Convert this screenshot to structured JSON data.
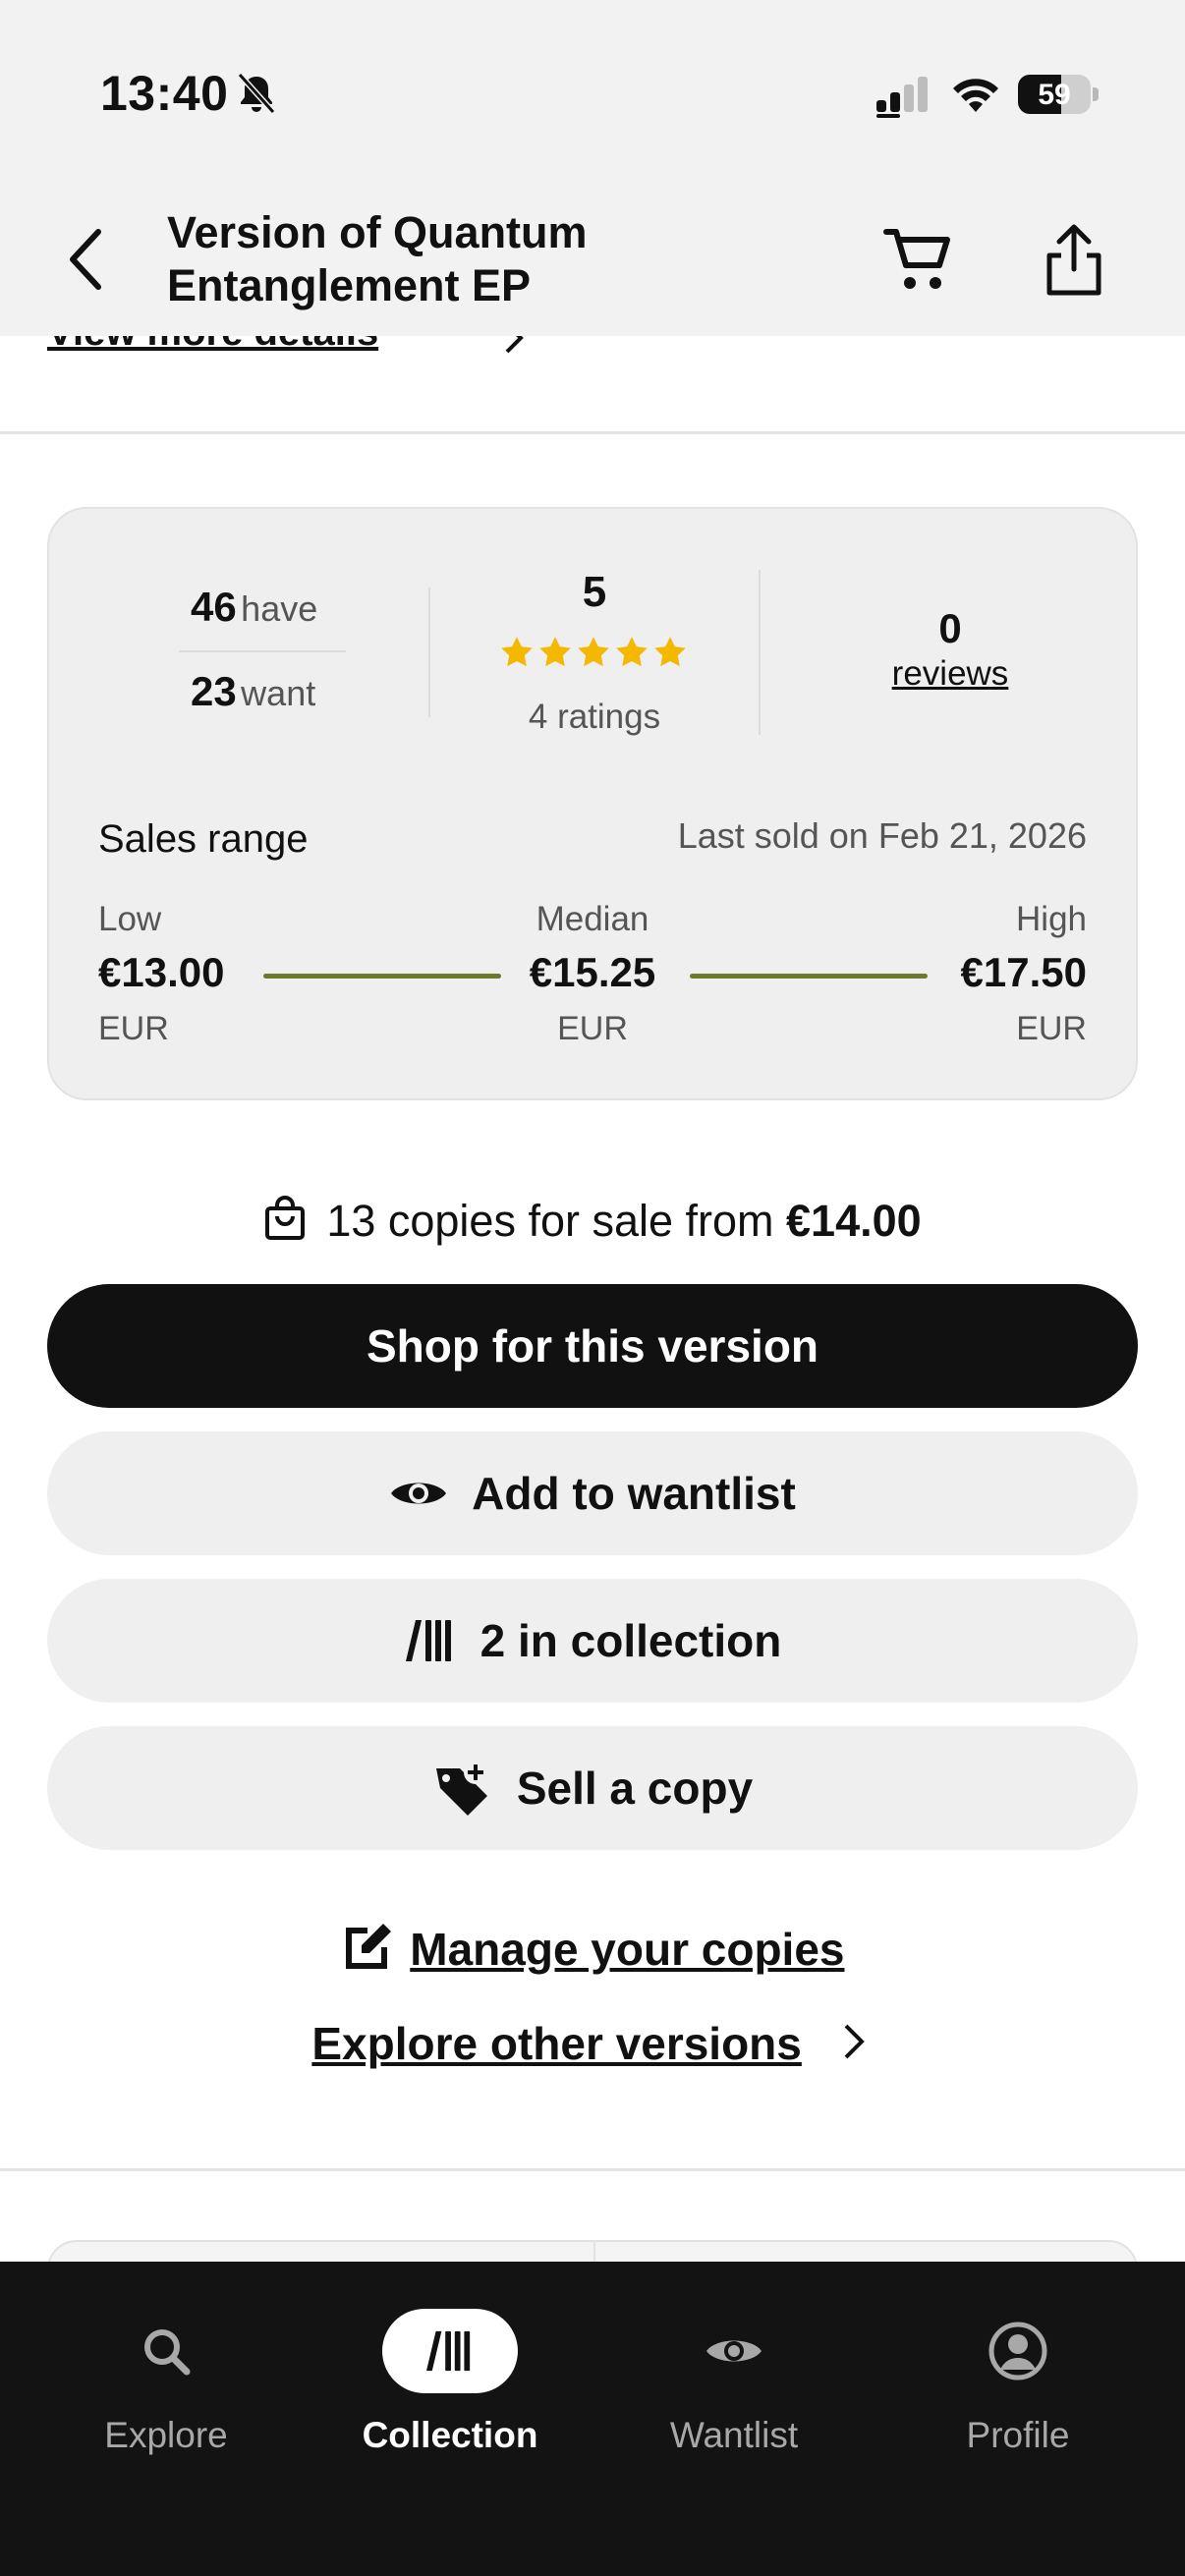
{
  "status_bar": {
    "time": "13:40",
    "battery": "59",
    "battery_level": 0.59
  },
  "header": {
    "title": "Version of Quantum Entanglement EP"
  },
  "view_more_details": "View more details",
  "stats": {
    "have_count": "46",
    "have_label": "have",
    "want_count": "23",
    "want_label": "want",
    "rating": "5",
    "stars": 5,
    "ratings_count": "4 ratings",
    "reviews_count": "0",
    "reviews_label": "reviews"
  },
  "sales_range": {
    "title": "Sales range",
    "last_sold": "Last sold on Feb 21, 2026",
    "low_label": "Low",
    "low": "€13.00",
    "median_label": "Median",
    "median": "€15.25",
    "high_label": "High",
    "high": "€17.50",
    "currency": "EUR",
    "line_color": "#6b7a2b"
  },
  "for_sale": {
    "text": "13 copies for sale from ",
    "price": "€14.00"
  },
  "actions": {
    "shop": "Shop for this version",
    "wantlist": "Add to wantlist",
    "collection": "2 in collection",
    "sell": "Sell a copy"
  },
  "links": {
    "manage": "Manage your copies",
    "explore_versions": "Explore other versions"
  },
  "bottom_nav": [
    {
      "label": "Explore",
      "icon": "search-icon",
      "active": false
    },
    {
      "label": "Collection",
      "icon": "collection-icon",
      "active": true
    },
    {
      "label": "Wantlist",
      "icon": "eye-icon",
      "active": false
    },
    {
      "label": "Profile",
      "icon": "profile-icon",
      "active": false
    }
  ],
  "colors": {
    "primary": "#111111",
    "star": "#f5b800",
    "nav_bg": "#131313"
  }
}
